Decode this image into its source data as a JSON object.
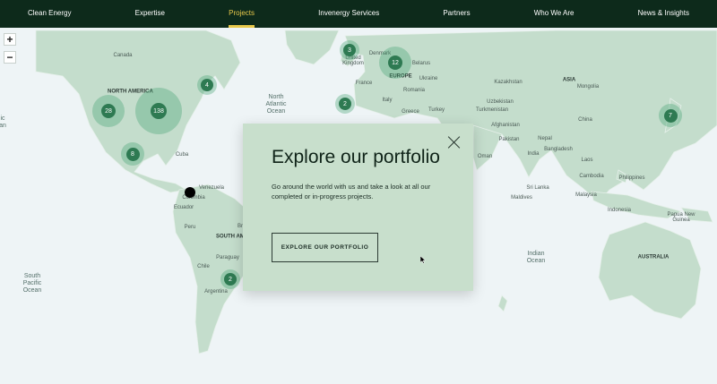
{
  "nav": {
    "items": [
      "Clean Energy",
      "Expertise",
      "Projects",
      "Invenergy Services",
      "Partners",
      "Who We Are",
      "News & Insights"
    ],
    "active": "Projects"
  },
  "map": {
    "zoom_in": "+",
    "zoom_out": "−",
    "labels": {
      "canada": "Canada",
      "north_america": "NORTH AMERICA",
      "north_atlantic": "North Atlantic Ocean",
      "cuba": "Cuba",
      "venezuela": "Venezuela",
      "colombia": "Colombia",
      "ecuador": "Ecuador",
      "peru": "Peru",
      "south_america": "SOUTH AMERICA",
      "brazil_part": "Br",
      "paraguay": "Paraguay",
      "chile": "Chile",
      "argentina": "Argentina",
      "south_pacific": "South Pacific Ocean",
      "pacific_left": "ic",
      "pacific_left_2": "an",
      "denmark": "Denmark",
      "united_kingdom": "United Kingdom",
      "europe": "EUROPE",
      "belarus": "Belarus",
      "ukraine": "Ukraine",
      "france": "France",
      "romania": "Romania",
      "italy": "Italy",
      "greece": "Greece",
      "turkey": "Turkey",
      "kazakhstan": "Kazakhstan",
      "mongolia": "Mongolia",
      "asia": "ASIA",
      "uzbekistan": "Uzbekistan",
      "turkmenistan": "Turkmenistan",
      "afghanistan": "Afghanistan",
      "china": "China",
      "pakistan": "Pakistan",
      "nepal": "Nepal",
      "oman": "Oman",
      "india": "India",
      "bangladesh": "Bangladesh",
      "laos": "Laos",
      "cambodia": "Cambodia",
      "philippines": "Philippines",
      "sri_lanka": "Sri Lanka",
      "maldives": "Maldives",
      "malaysia": "Malaysia",
      "indonesia": "Indonesia",
      "png": "Papua New Guinea",
      "indian_ocean": "Indian Ocean",
      "australia": "AUSTRALIA"
    },
    "clusters": [
      "3",
      "12",
      "4",
      "28",
      "138",
      "2",
      "8",
      "7",
      "2"
    ]
  },
  "modal": {
    "title": "Explore our portfolio",
    "body": "Go around the world with us and take a look at all our completed or in-progress projects.",
    "cta": "EXPLORE OUR PORTFOLIO"
  },
  "colors": {
    "nav_bg": "#0d2a1b",
    "accent": "#e7c84a",
    "land": "#c4ddcc",
    "cluster": "#2e7a52",
    "modal_bg": "#c8dfcc"
  }
}
